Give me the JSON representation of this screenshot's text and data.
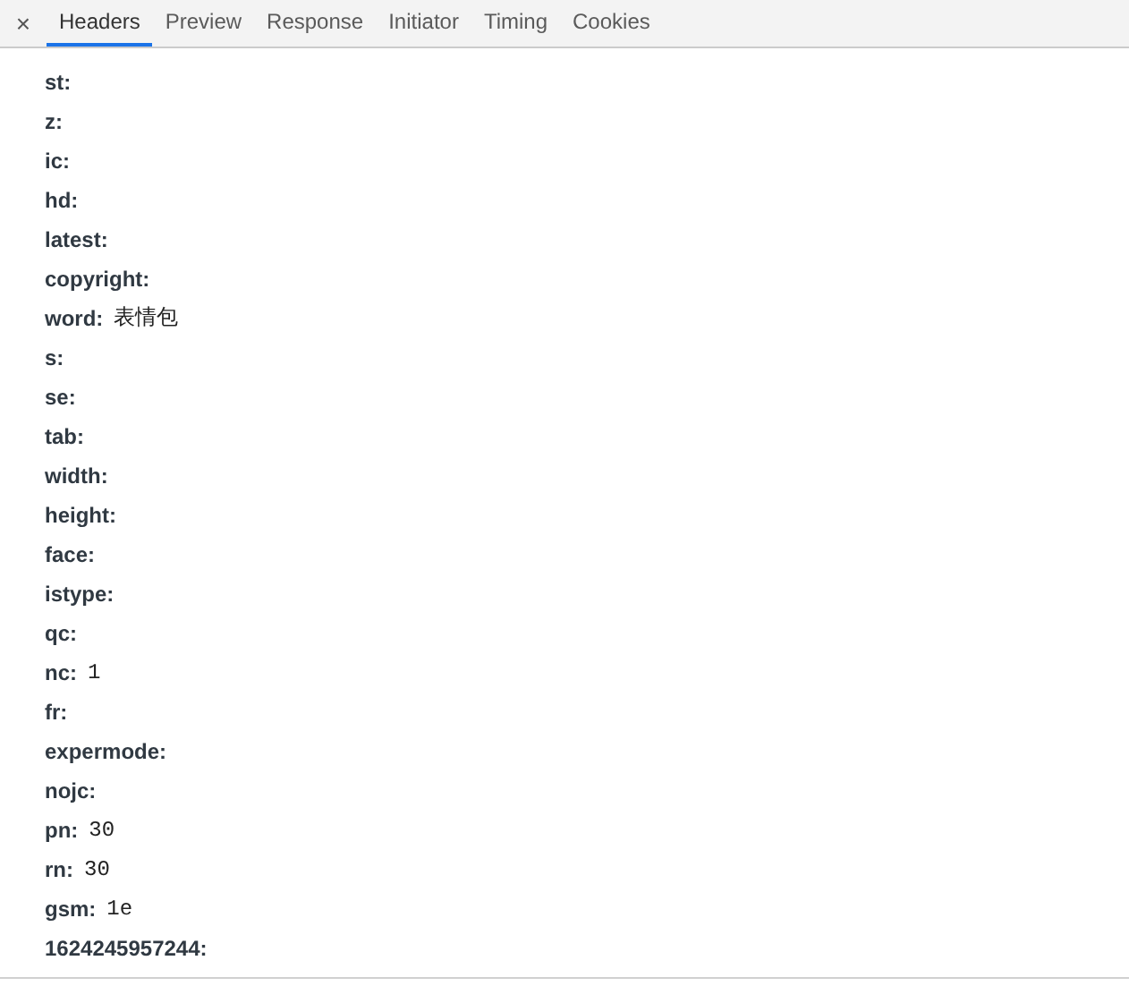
{
  "tabs": [
    {
      "label": "Headers",
      "selected": true
    },
    {
      "label": "Preview",
      "selected": false
    },
    {
      "label": "Response",
      "selected": false
    },
    {
      "label": "Initiator",
      "selected": false
    },
    {
      "label": "Timing",
      "selected": false
    },
    {
      "label": "Cookies",
      "selected": false
    }
  ],
  "close": "×",
  "params": [
    {
      "name": "st:"
    },
    {
      "name": "z:"
    },
    {
      "name": "ic:"
    },
    {
      "name": "hd:"
    },
    {
      "name": "latest:"
    },
    {
      "name": "copyright:"
    },
    {
      "name": "word:",
      "value": "表情包"
    },
    {
      "name": "s:"
    },
    {
      "name": "se:"
    },
    {
      "name": "tab:"
    },
    {
      "name": "width:"
    },
    {
      "name": "height:"
    },
    {
      "name": "face:"
    },
    {
      "name": "istype:"
    },
    {
      "name": "qc:"
    },
    {
      "name": "nc:",
      "value": "1"
    },
    {
      "name": "fr:"
    },
    {
      "name": "expermode:"
    },
    {
      "name": "nojc:"
    },
    {
      "name": "pn:",
      "value": "30"
    },
    {
      "name": "rn:",
      "value": "30"
    },
    {
      "name": "gsm:",
      "value": "1e"
    },
    {
      "name": "1624245957244:"
    }
  ]
}
